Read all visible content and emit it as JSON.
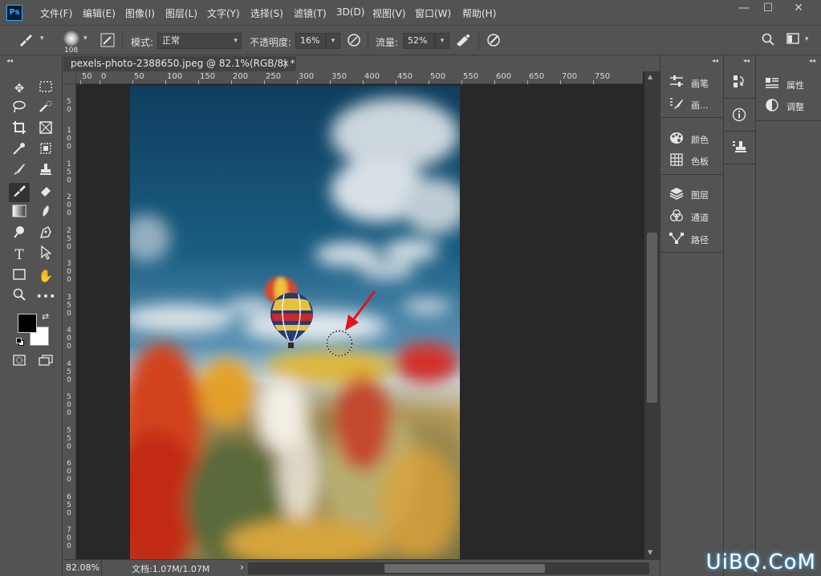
{
  "app": {
    "logo": "Ps"
  },
  "menu": [
    "文件(F)",
    "编辑(E)",
    "图像(I)",
    "图层(L)",
    "文字(Y)",
    "选择(S)",
    "滤镜(T)",
    "3D(D)",
    "视图(V)",
    "窗口(W)",
    "帮助(H)"
  ],
  "window_controls": {
    "minimize": "—",
    "maximize": "☐",
    "close": "✕"
  },
  "options": {
    "brush_size": "108",
    "mode_label": "模式:",
    "mode_value": "正常",
    "opacity_label": "不透明度:",
    "opacity_value": "16%",
    "flow_label": "流量:",
    "flow_value": "52%"
  },
  "document": {
    "tab_title": "pexels-photo-2388650.jpeg @ 82.1%(RGB/8) *",
    "close": "×",
    "ruler_h": [
      "50",
      "0",
      "50",
      "100",
      "150",
      "200",
      "250",
      "300",
      "350",
      "400",
      "450",
      "500",
      "550",
      "600",
      "650",
      "700",
      "750"
    ],
    "ruler_v": [
      "5\n0",
      "1\n0\n0",
      "1\n5\n0",
      "2\n0\n0",
      "2\n5\n0",
      "3\n0\n0",
      "3\n5\n0",
      "4\n0\n0",
      "4\n5\n0",
      "5\n0\n0",
      "5\n5\n0",
      "6\n0\n0",
      "6\n5\n0",
      "7\n0\n0"
    ]
  },
  "status": {
    "zoom": "82.08%",
    "doc_info": "文档:1.07M/1.07M",
    "arrow": "›"
  },
  "panels": {
    "dock1": [
      {
        "icon": "brush-settings-icon",
        "label": "画笔"
      },
      {
        "icon": "brush-presets-icon",
        "label": "画..."
      },
      {
        "icon": "palette-icon",
        "label": "颜色"
      },
      {
        "icon": "swatches-icon",
        "label": "色板"
      },
      {
        "icon": "layers-icon",
        "label": "图层"
      },
      {
        "icon": "channels-icon",
        "label": "通道"
      },
      {
        "icon": "paths-icon",
        "label": "路径"
      }
    ],
    "dock3": [
      {
        "icon": "properties-icon",
        "label": "属性"
      },
      {
        "icon": "adjustments-icon",
        "label": "调整"
      }
    ]
  },
  "watermark": "UiBQ.CoM"
}
